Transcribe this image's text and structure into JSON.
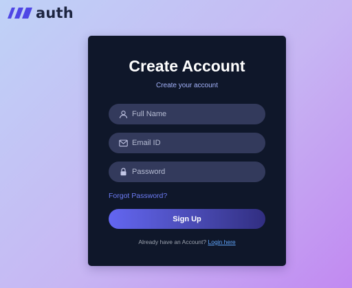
{
  "brand": {
    "name": "auth",
    "logo_icon": "slash-stripes-logo"
  },
  "form": {
    "title": "Create Account",
    "subtitle": "Create your account",
    "fields": {
      "full_name": {
        "placeholder": "Full Name",
        "value": "",
        "icon": "user-icon"
      },
      "email": {
        "placeholder": "Email ID",
        "value": "",
        "icon": "mail-icon"
      },
      "password": {
        "placeholder": "Password",
        "value": "",
        "icon": "lock-icon"
      }
    },
    "forgot_label": "Forgot Password?",
    "submit_label": "Sign Up",
    "footer_text": "Already have an Account?",
    "login_label": "Login here"
  },
  "colors": {
    "card_bg": "#0f172a",
    "input_bg": "#333a5c",
    "accent": "#6366f1",
    "link": "#60a5fa",
    "brand_blue": "#4f46e5"
  }
}
